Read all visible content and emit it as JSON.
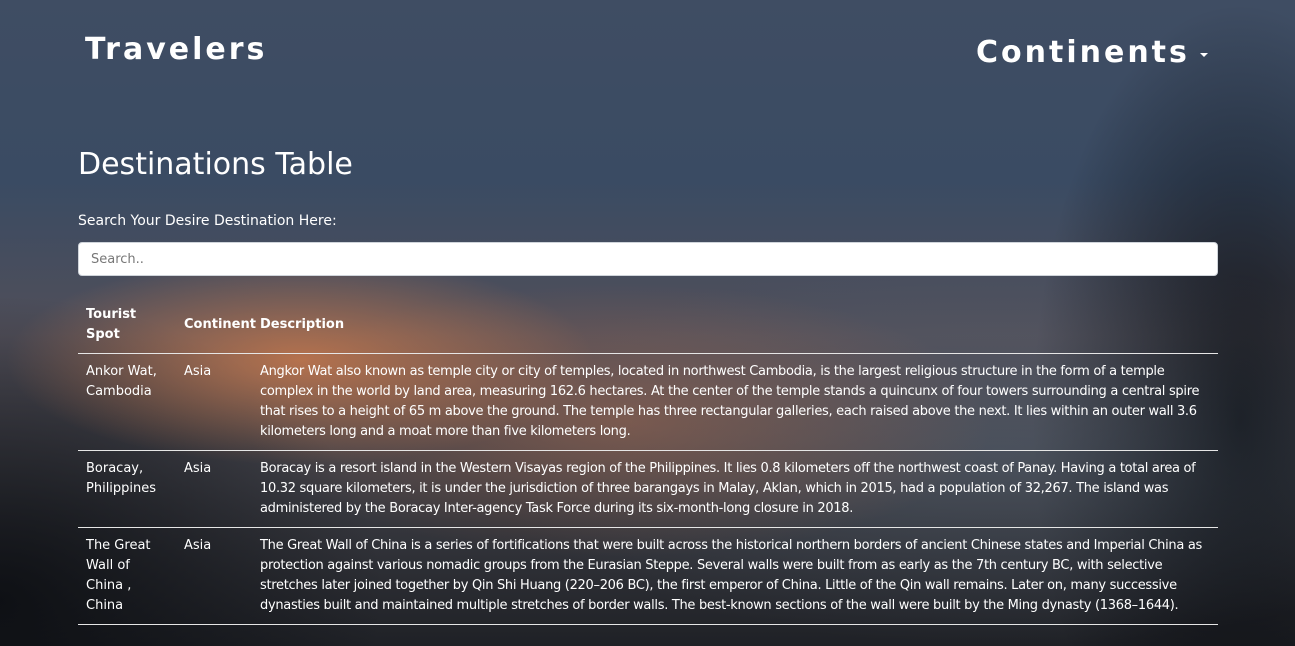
{
  "navbar": {
    "brand": "Travelers",
    "dropdown_label": "Continents",
    "dropdown_icon": "caret-down-icon"
  },
  "main": {
    "title": "Destinations Table",
    "search_label": "Search Your Desire Destination Here:",
    "search_placeholder": "Search..",
    "search_value": ""
  },
  "table": {
    "headers": [
      "Tourist Spot",
      "Continent",
      "Description"
    ],
    "rows": [
      {
        "spot": "Ankor Wat, Cambodia",
        "continent": "Asia",
        "description": "Angkor Wat also known as temple city or city of temples, located in northwest Cambodia, is the largest religious structure in the form of a temple complex in the world by land area, measuring 162.6 hectares. At the center of the temple stands a quincunx of four towers surrounding a central spire that rises to a height of 65 m above the ground. The temple has three rectangular galleries, each raised above the next. It lies within an outer wall 3.6 kilometers long and a moat more than five kilometers long."
      },
      {
        "spot": "Boracay, Philippines",
        "continent": "Asia",
        "description": "Boracay is a resort island in the Western Visayas region of the Philippines. It lies 0.8 kilometers off the northwest coast of Panay. Having a total area of 10.32 square kilometers, it is under the jurisdiction of three barangays in Malay, Aklan, which in 2015, had a population of 32,267. The island was administered by the Boracay Inter-agency Task Force during its six-month-long closure in 2018."
      },
      {
        "spot": "The Great Wall of China , China",
        "continent": "Asia",
        "description": "The Great Wall of China is a series of fortifications that were built across the historical northern borders of ancient Chinese states and Imperial China as protection against various nomadic groups from the Eurasian Steppe. Several walls were built from as early as the 7th century BC, with selective stretches later joined together by Qin Shi Huang (220–206 BC), the first emperor of China. Little of the Qin wall remains. Later on, many successive dynasties built and maintained multiple stretches of border walls. The best-known sections of the wall were built by the Ming dynasty (1368–1644)."
      }
    ]
  }
}
